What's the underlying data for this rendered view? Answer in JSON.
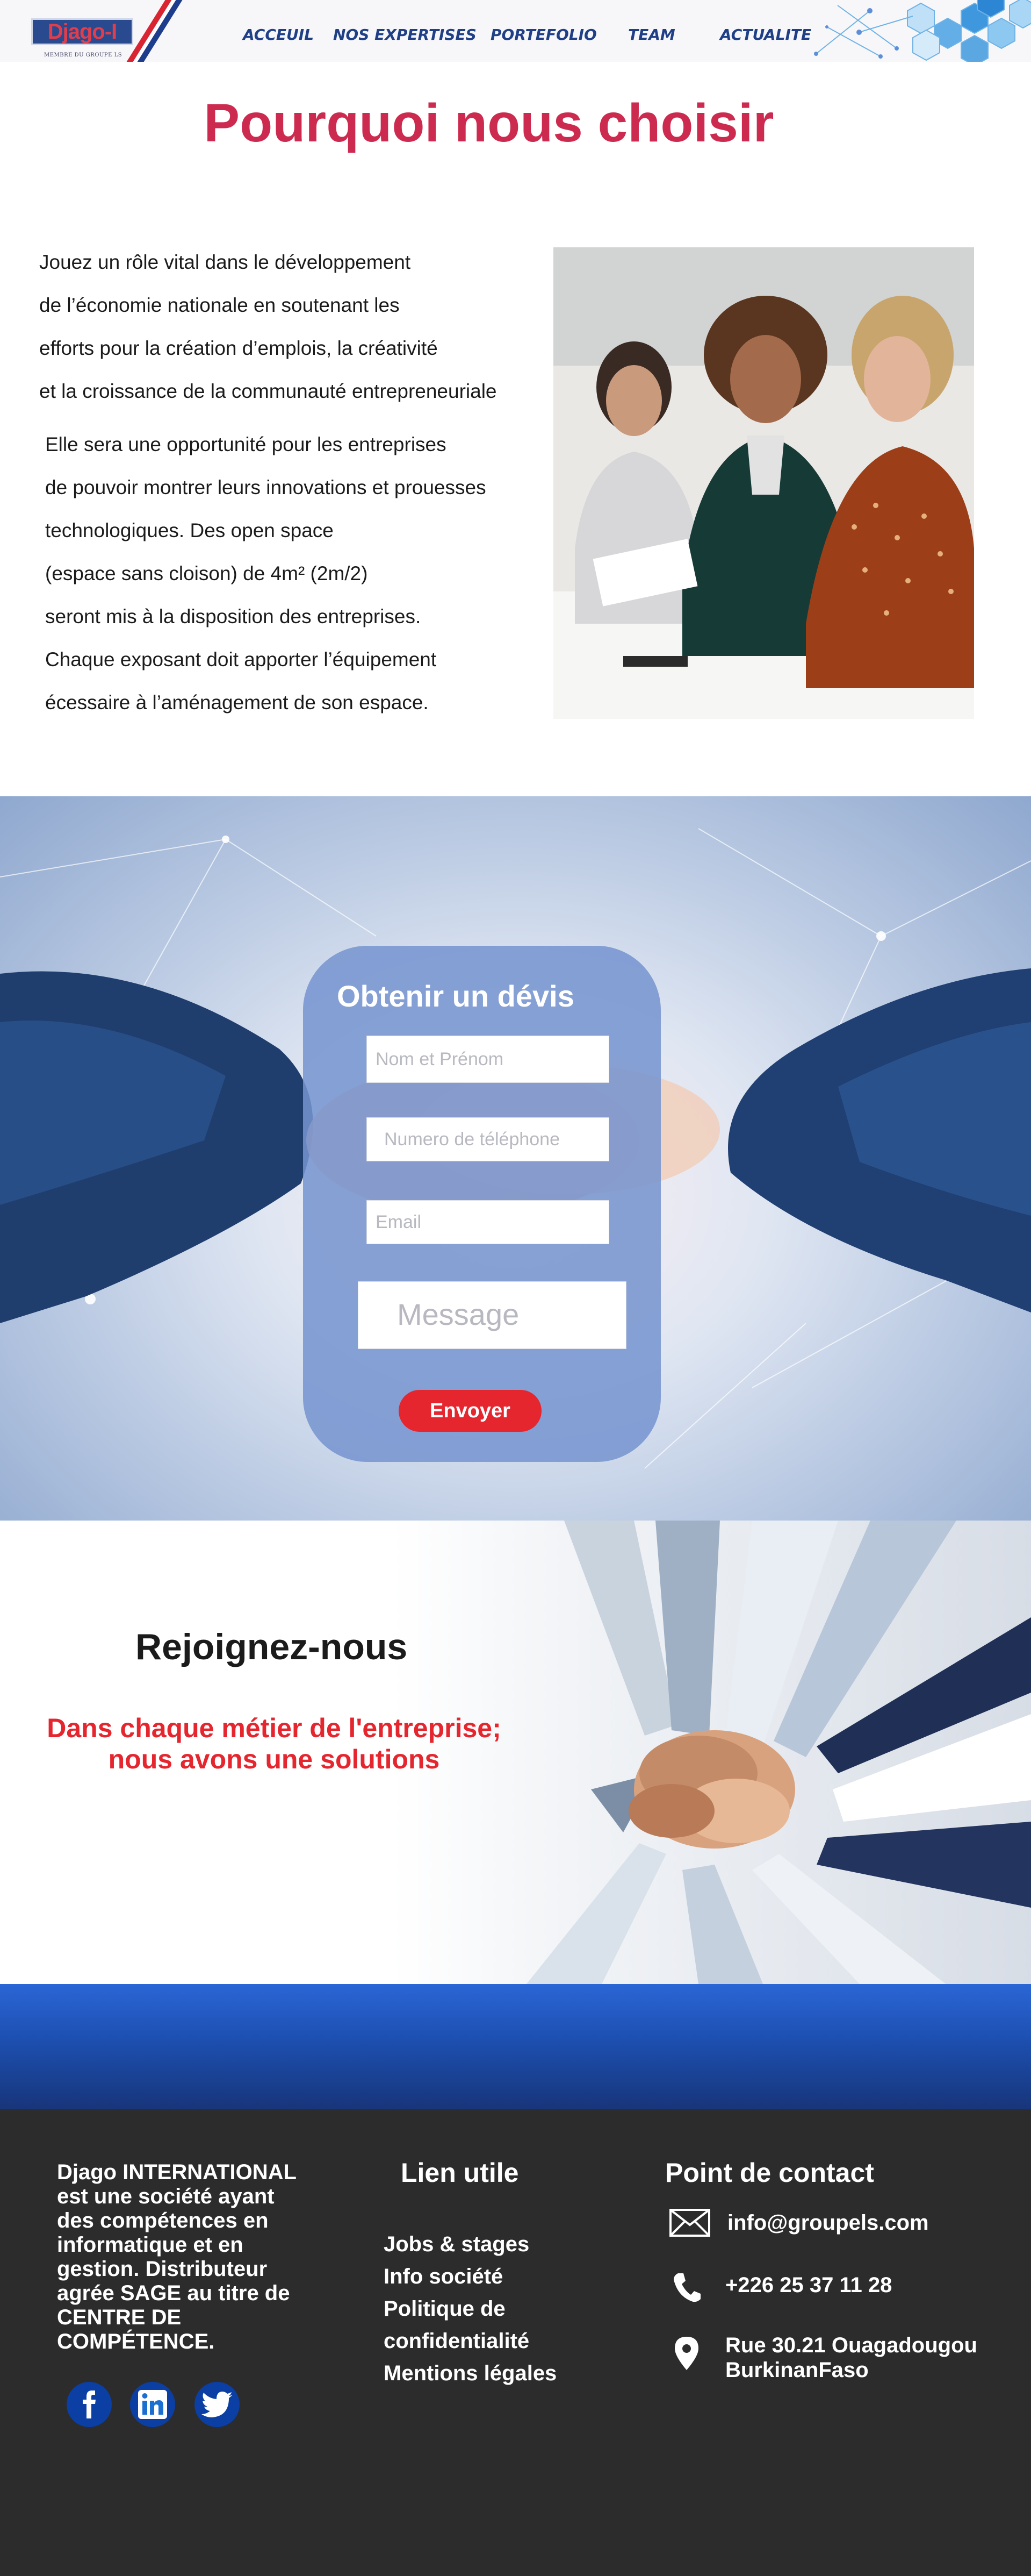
{
  "header": {
    "logo_text": "Djago-I",
    "logo_subtitle": "MEMBRE DU GROUPE LS",
    "nav": [
      "ACCEUIL",
      "NOS EXPERTISES",
      "PORTEFOLIO",
      "TEAM",
      "ACTUALITE"
    ]
  },
  "why": {
    "title": "Pourquoi nous choisir",
    "paragraph1": "Jouez un rôle vital dans le développement\nde l’économie nationale en soutenant les\nefforts pour la création d’emplois, la créativité\net la croissance de la communauté entrepreneuriale",
    "paragraph2": "Elle sera une opportunité pour les entreprises\nde pouvoir montrer leurs innovations et prouesses\ntechnologiques. Des open space\n(espace sans cloison) de 4m² (2m/2)\nseront mis à la disposition des entreprises.\n Chaque exposant doit apporter l’équipement\nécessaire à l’aménagement de son espace."
  },
  "quote": {
    "title": "Obtenir un dévis",
    "name_placeholder": "Nom et Prénom",
    "phone_placeholder": "Numero de téléphone",
    "email_placeholder": "Email",
    "message_placeholder": "Message",
    "submit_label": "Envoyer"
  },
  "join": {
    "title": "Rejoignez-nous",
    "subtitle": "Dans chaque métier de l'entreprise;\nnous avons une solutions"
  },
  "footer": {
    "about": "Djago INTERNATIONAL est une société ayant des compétences en informatique et en gestion. Distributeur agrée SAGE au titre de CENTRE DE COMPÉTENCE.",
    "social": [
      "facebook-icon",
      "linkedin-icon",
      "twitter-icon"
    ],
    "links_title": "Lien utile",
    "links": [
      "Jobs & stages",
      "Info société",
      "Politique de",
      "confidentialité",
      "Mentions légales"
    ],
    "contact_title": "Point de contact",
    "email": "info@groupels.com",
    "phone": "+226 25 37 11 28",
    "address_line1": "Rue 30.21 Ouagadougou",
    "address_line2": "BurkinanFaso"
  },
  "colors": {
    "nav_text": "#1f3f86",
    "title_red": "#cc2b4f",
    "accent_red": "#e5262f",
    "footer_bg": "#2d2c2c",
    "social_blue": "#0b3fa4"
  }
}
